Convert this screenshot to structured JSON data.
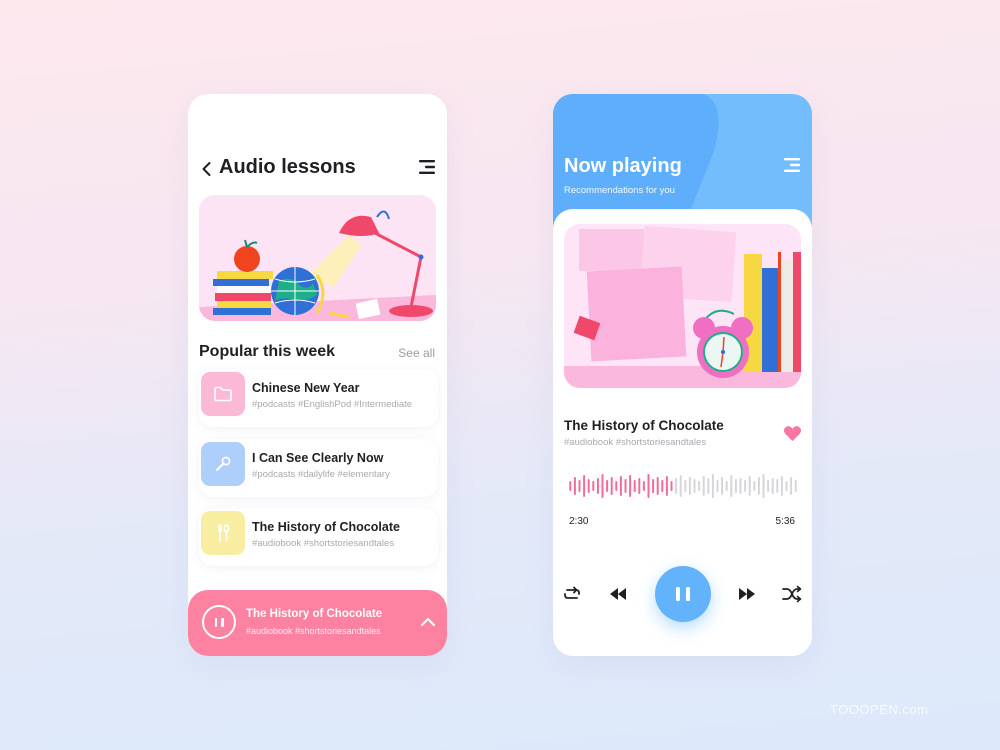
{
  "left_screen": {
    "title": "Audio lessons",
    "icons": {
      "back": "chevron-left-icon",
      "menu": "menu-icon"
    },
    "hero_illustration": "desk-with-books-globe-apple-lamp",
    "section": {
      "title": "Popular this week",
      "see_all_label": "See all"
    },
    "lessons": [
      {
        "name": "Chinese New Year",
        "tags": "#podcasts #EnglishPod #Intermediate",
        "icon": "folder-icon",
        "color": "#fbb9d6"
      },
      {
        "name": "I Can See Clearly Now",
        "tags": "#podcasts #dailylife #elementary",
        "icon": "microphone-icon",
        "color": "#aecffb"
      },
      {
        "name": "The History of Chocolate",
        "tags": "#audiobook #shortstoriesandtales",
        "icon": "cutlery-icon",
        "color": "#f8eda1"
      }
    ],
    "mini_player": {
      "title": "The History of Chocolate",
      "tags": "#audiobook #shortstoriesandtales",
      "state": "playing",
      "color": "#fd82a2"
    }
  },
  "right_screen": {
    "title": "Now playing",
    "subtitle": "Recommendations for you",
    "header_color": "#74bdfd",
    "cover_illustration": "sticky-notes-alarm-clock-books",
    "track": {
      "title": "The History of Chocolate",
      "tags": "#audiobook #shortstoriesandtales",
      "liked": true
    },
    "progress": {
      "current_time": "2:30",
      "total_time": "5:36",
      "fraction_played": 0.45,
      "played_color": "#f56b98",
      "unplayed_color": "#d6d6da"
    },
    "controls": [
      "repeat",
      "rewind",
      "pause",
      "fast-forward",
      "shuffle"
    ],
    "accent": "#62b3fb"
  },
  "watermark": "TOOOPEN.com"
}
